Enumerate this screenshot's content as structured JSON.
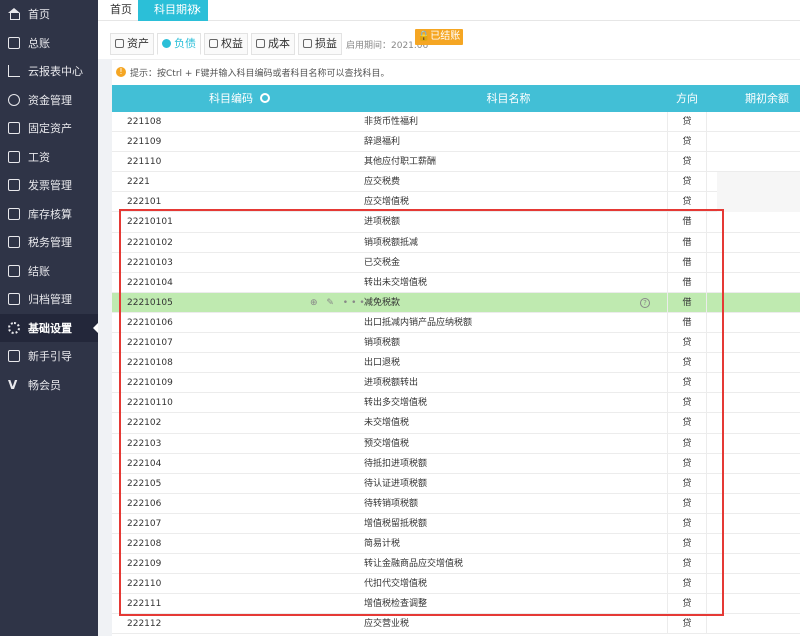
{
  "sidebar": {
    "items": [
      {
        "label": "首页",
        "icon": "home-icon"
      },
      {
        "label": "总账",
        "icon": "ledger-icon"
      },
      {
        "label": "云报表中心",
        "icon": "chart-icon"
      },
      {
        "label": "资金管理",
        "icon": "money-icon"
      },
      {
        "label": "固定资产",
        "icon": "asset-icon"
      },
      {
        "label": "工资",
        "icon": "salary-icon"
      },
      {
        "label": "发票管理",
        "icon": "invoice-icon"
      },
      {
        "label": "库存核算",
        "icon": "inventory-icon"
      },
      {
        "label": "税务管理",
        "icon": "tax-icon"
      },
      {
        "label": "结账",
        "icon": "checkout-icon"
      },
      {
        "label": "归档管理",
        "icon": "archive-icon"
      },
      {
        "label": "基础设置",
        "icon": "gear-icon"
      },
      {
        "label": "新手引导",
        "icon": "guide-icon"
      },
      {
        "label": "畅会员",
        "icon": "vip-icon"
      }
    ],
    "active_index": 11
  },
  "tabs": {
    "home": "首页",
    "subject": "科目期初",
    "close": "×"
  },
  "categories": [
    {
      "label": "资产",
      "icon": "asset-tab-icon"
    },
    {
      "label": "负债",
      "icon": "liability-tab-icon"
    },
    {
      "label": "权益",
      "icon": "equity-tab-icon"
    },
    {
      "label": "成本",
      "icon": "cost-tab-icon"
    },
    {
      "label": "损益",
      "icon": "profit-loss-tab-icon"
    }
  ],
  "active_category": 1,
  "enable_date": "启用期间：2021.06",
  "closed_badge": "已结账",
  "tip": "提示：按Ctrl + F键并输入科目编码或者科目名称可以查找科目。",
  "table": {
    "headers": {
      "code": "科目编码",
      "name": "科目名称",
      "direction": "方向",
      "balance": "期初余额"
    },
    "rows": [
      {
        "code": "221108",
        "name": "非货币性福利",
        "dir": "贷"
      },
      {
        "code": "221109",
        "name": "辞退福利",
        "dir": "贷"
      },
      {
        "code": "221110",
        "name": "其他应付职工薪酬",
        "dir": "贷"
      },
      {
        "code": "2221",
        "name": "应交税费",
        "dir": "贷"
      },
      {
        "code": "222101",
        "name": "应交增值税",
        "dir": "贷"
      },
      {
        "code": "22210101",
        "name": "进项税额",
        "dir": "借"
      },
      {
        "code": "22210102",
        "name": "销项税额抵减",
        "dir": "借"
      },
      {
        "code": "22210103",
        "name": "已交税金",
        "dir": "借"
      },
      {
        "code": "22210104",
        "name": "转出未交增值税",
        "dir": "借"
      },
      {
        "code": "22210105",
        "name": "减免税款",
        "dir": "借"
      },
      {
        "code": "22210106",
        "name": "出口抵减内销产品应纳税额",
        "dir": "借"
      },
      {
        "code": "22210107",
        "name": "销项税额",
        "dir": "贷"
      },
      {
        "code": "22210108",
        "name": "出口退税",
        "dir": "贷"
      },
      {
        "code": "22210109",
        "name": "进项税额转出",
        "dir": "贷"
      },
      {
        "code": "22210110",
        "name": "转出多交增值税",
        "dir": "贷"
      },
      {
        "code": "222102",
        "name": "未交增值税",
        "dir": "贷"
      },
      {
        "code": "222103",
        "name": "预交增值税",
        "dir": "贷"
      },
      {
        "code": "222104",
        "name": "待抵扣进项税额",
        "dir": "贷"
      },
      {
        "code": "222105",
        "name": "待认证进项税额",
        "dir": "贷"
      },
      {
        "code": "222106",
        "name": "待转销项税额",
        "dir": "贷"
      },
      {
        "code": "222107",
        "name": "增值税留抵税额",
        "dir": "贷"
      },
      {
        "code": "222108",
        "name": "简易计税",
        "dir": "贷"
      },
      {
        "code": "222109",
        "name": "转让金融商品应交增值税",
        "dir": "贷"
      },
      {
        "code": "222110",
        "name": "代扣代交增值税",
        "dir": "贷"
      },
      {
        "code": "222111",
        "name": "增值税检查调整",
        "dir": "贷"
      },
      {
        "code": "222112",
        "name": "应交营业税",
        "dir": "贷"
      }
    ],
    "highlight_index": 9,
    "row_actions": "⊕ ✎ •••",
    "help_mark": "?",
    "shaded_balance_rows": [
      3,
      4
    ]
  },
  "colors": {
    "sidebar_bg": "#2f3447",
    "accent": "#2bbfd8",
    "header_bg": "#42bfd6",
    "highlight_row": "#bfeab0",
    "badge": "#f5a623",
    "annotation_box": "#e53935"
  }
}
